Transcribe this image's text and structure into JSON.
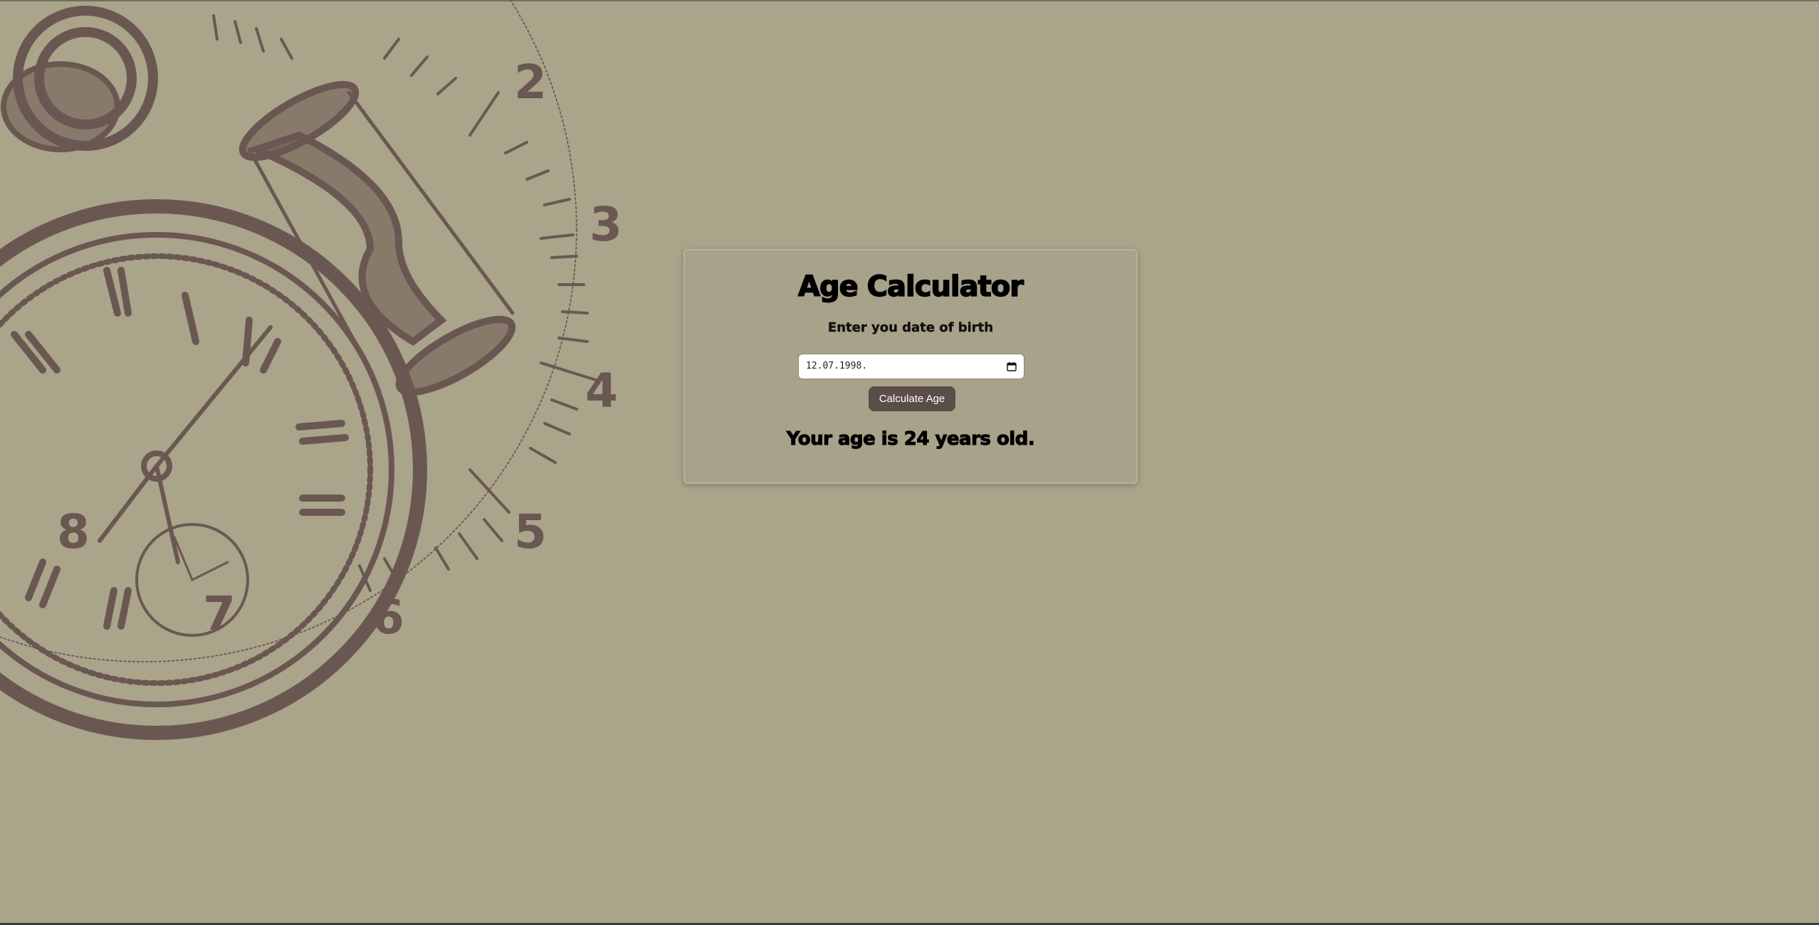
{
  "card": {
    "title": "Age Calculator",
    "dob_label": "Enter you date of birth",
    "dob_value": "12.07.1998.",
    "button_label": "Calculate Age",
    "result": "Your age is 24 years old."
  },
  "background": {
    "illustration": "pocket-watch-and-hourglass",
    "dial_numbers": [
      "2",
      "3",
      "4",
      "5",
      "6",
      "7",
      "8"
    ]
  },
  "colors": {
    "page_background": "#a9a48a",
    "illustration_ink": "#6b5752",
    "button_background": "#5b4d47",
    "button_text": "#ffffff"
  },
  "icons": {
    "date_picker": "calendar-icon"
  }
}
